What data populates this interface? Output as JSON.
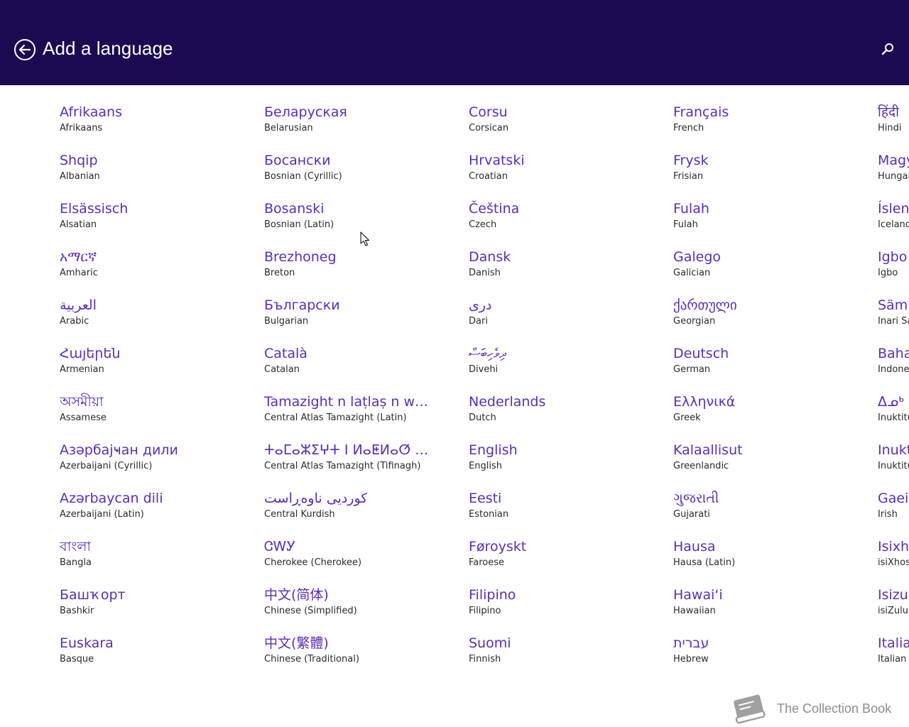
{
  "header": {
    "title": "Add a language",
    "back_icon": "back-arrow-circle-icon",
    "search_icon": "search-icon",
    "background": "#1b0a51"
  },
  "colors": {
    "accent": "#5b2db7",
    "subtext": "#2a2a2a",
    "background": "#ffffff"
  },
  "columns": [
    {
      "items": [
        {
          "native": "Afrikaans",
          "english": "Afrikaans"
        },
        {
          "native": "Shqip",
          "english": "Albanian"
        },
        {
          "native": "Elsässisch",
          "english": "Alsatian"
        },
        {
          "native": "አማርኛ",
          "english": "Amharic"
        },
        {
          "native": "العربية",
          "english": "Arabic"
        },
        {
          "native": "Հայերեն",
          "english": "Armenian"
        },
        {
          "native": "অসমীয়া",
          "english": "Assamese"
        },
        {
          "native": "Азәрбајҹан дили",
          "english": "Azerbaijani (Cyrillic)"
        },
        {
          "native": "Azərbaycan dili",
          "english": "Azerbaijani (Latin)"
        },
        {
          "native": "বাংলা",
          "english": "Bangla"
        },
        {
          "native": "Башҡорт",
          "english": "Bashkir"
        },
        {
          "native": "Euskara",
          "english": "Basque"
        }
      ]
    },
    {
      "items": [
        {
          "native": "Беларуская",
          "english": "Belarusian"
        },
        {
          "native": "Босански",
          "english": "Bosnian (Cyrillic)"
        },
        {
          "native": "Bosanski",
          "english": "Bosnian (Latin)"
        },
        {
          "native": "Brezhoneg",
          "english": "Breton"
        },
        {
          "native": "Български",
          "english": "Bulgarian"
        },
        {
          "native": "Català",
          "english": "Catalan"
        },
        {
          "native": "Tamazight n laṭlaṣ n wa...",
          "english": "Central Atlas Tamazight (Latin)"
        },
        {
          "native": "ⵜⴰⵎⴰⵣⵉⵖⵜ ⵏ ⵍⴰⵟⵍⴰⵚ ⵏ ⵡ...",
          "english": "Central Atlas Tamazight (Tifinagh)"
        },
        {
          "native": "کوردیی ناوەڕاست",
          "english": "Central Kurdish"
        },
        {
          "native": "ᏣᎳᎩ",
          "english": "Cherokee (Cherokee)"
        },
        {
          "native": "中文(简体)",
          "english": "Chinese (Simplified)"
        },
        {
          "native": "中文(繁體)",
          "english": "Chinese (Traditional)"
        }
      ]
    },
    {
      "items": [
        {
          "native": "Corsu",
          "english": "Corsican"
        },
        {
          "native": "Hrvatski",
          "english": "Croatian"
        },
        {
          "native": "Čeština",
          "english": "Czech"
        },
        {
          "native": "Dansk",
          "english": "Danish"
        },
        {
          "native": "درى",
          "english": "Dari"
        },
        {
          "native": "ދިވެހިބަސް",
          "english": "Divehi"
        },
        {
          "native": "Nederlands",
          "english": "Dutch"
        },
        {
          "native": "English",
          "english": "English"
        },
        {
          "native": "Eesti",
          "english": "Estonian"
        },
        {
          "native": "Føroyskt",
          "english": "Faroese"
        },
        {
          "native": "Filipino",
          "english": "Filipino"
        },
        {
          "native": "Suomi",
          "english": "Finnish"
        }
      ]
    },
    {
      "items": [
        {
          "native": "Français",
          "english": "French"
        },
        {
          "native": "Frysk",
          "english": "Frisian"
        },
        {
          "native": "Fulah",
          "english": "Fulah"
        },
        {
          "native": "Galego",
          "english": "Galician"
        },
        {
          "native": "ქართული",
          "english": "Georgian"
        },
        {
          "native": "Deutsch",
          "english": "German"
        },
        {
          "native": "Ελληνικά",
          "english": "Greek"
        },
        {
          "native": "Kalaallisut",
          "english": "Greenlandic"
        },
        {
          "native": "ગુજરાતી",
          "english": "Gujarati"
        },
        {
          "native": "Hausa",
          "english": "Hausa (Latin)"
        },
        {
          "native": "Hawaiʻi",
          "english": "Hawaiian"
        },
        {
          "native": "עברית",
          "english": "Hebrew"
        }
      ]
    },
    {
      "items": [
        {
          "native": "हिंदी",
          "english": "Hindi"
        },
        {
          "native": "Magy",
          "english": "Hungar"
        },
        {
          "native": "Íslens",
          "english": "Iceland"
        },
        {
          "native": "Igbo",
          "english": "Igbo"
        },
        {
          "native": "Sämi",
          "english": "Inari Sa"
        },
        {
          "native": "Baha",
          "english": "Indone"
        },
        {
          "native": "ᐃᓄᒃ",
          "english": "Inuktitu"
        },
        {
          "native": "Inukt",
          "english": "Inuktitu"
        },
        {
          "native": "Gaeil",
          "english": "Irish"
        },
        {
          "native": "Isixh",
          "english": "isiXhos"
        },
        {
          "native": "Isizul",
          "english": "isiZulu"
        },
        {
          "native": "Italia",
          "english": "Italian"
        }
      ]
    }
  ],
  "watermark": {
    "text": "The Collection Book",
    "icon": "book-icon"
  },
  "cursor_icon": "mouse-pointer-icon"
}
